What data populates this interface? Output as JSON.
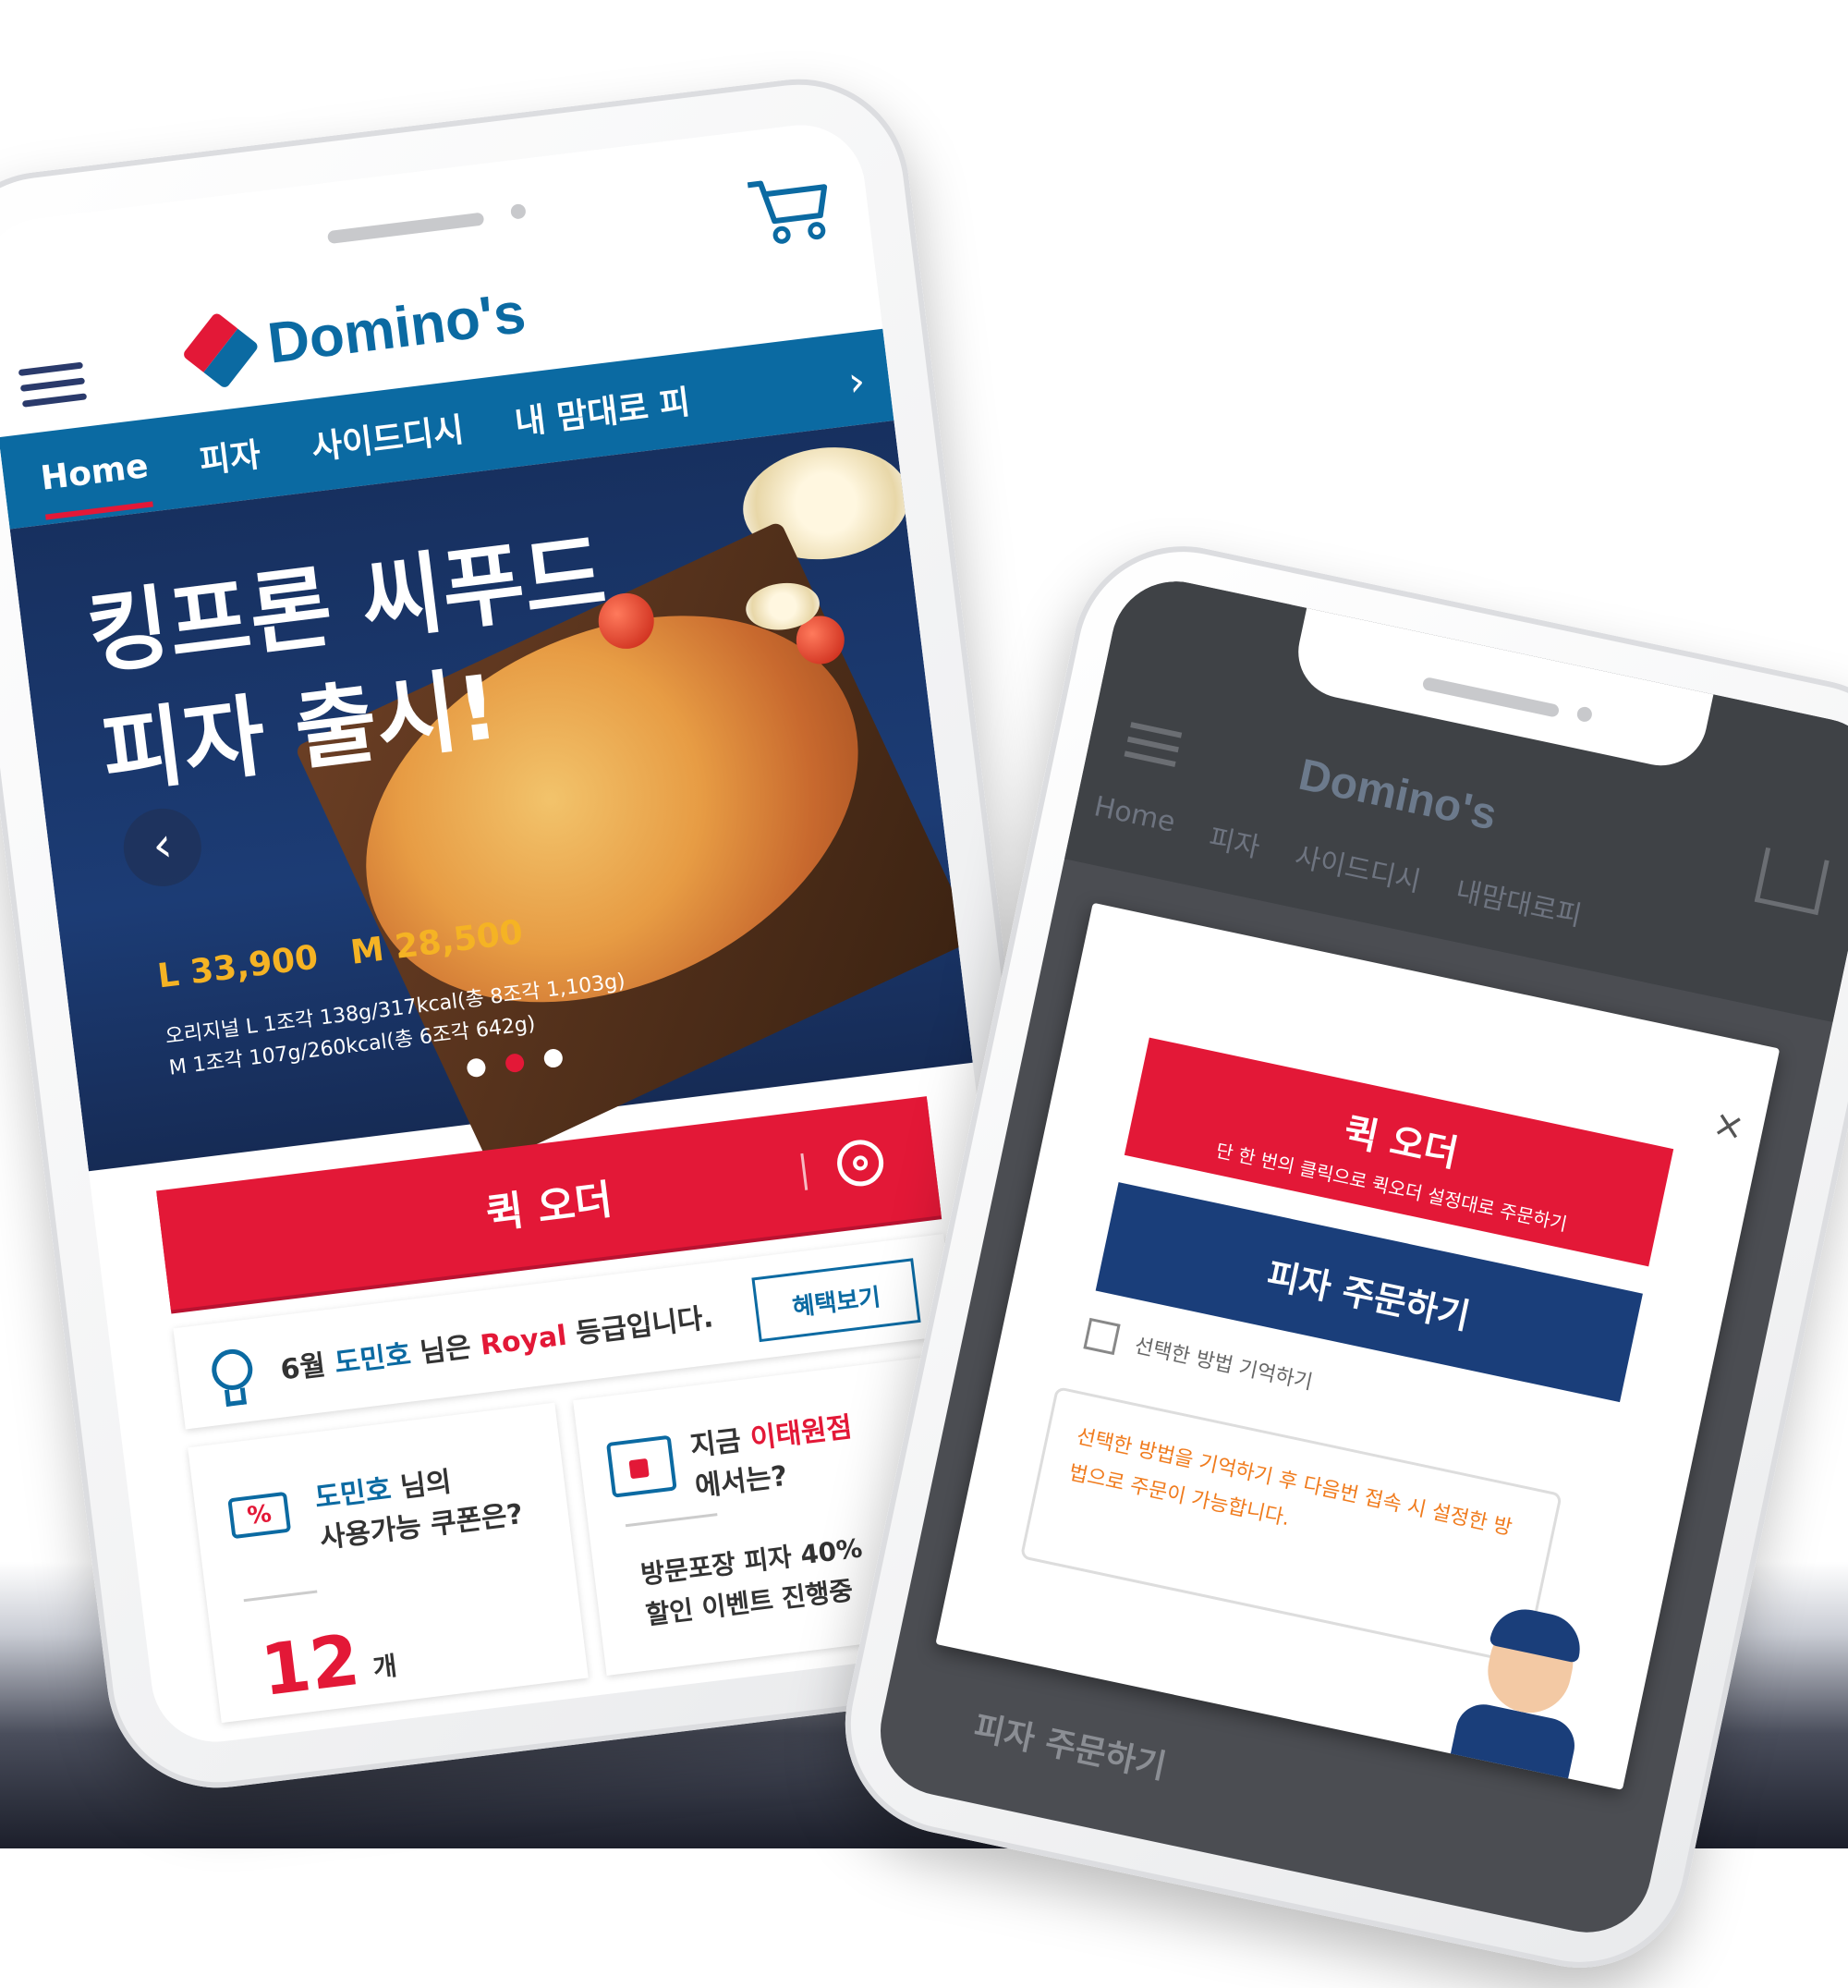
{
  "phone1": {
    "header": {
      "logo_text": "Domino's",
      "menu_icon": "hamburger-icon",
      "cart_icon": "cart-icon"
    },
    "nav": {
      "tabs": [
        {
          "label": "Home"
        },
        {
          "label": "피자"
        },
        {
          "label": "사이드디시"
        },
        {
          "label": "내 맘대로 피"
        }
      ],
      "more_icon": "chevron-right-icon",
      "more_glyph": "›"
    },
    "hero": {
      "title_line1": "킹프론 씨푸드",
      "title_line2": "피자 출시!",
      "prev_glyph": "‹",
      "price_l": "L 33,900",
      "price_m": "M 28,500",
      "detail_line1": "오리지널 L 1조각 138g/317kcal(총 8조각 1,103g)",
      "detail_line2": "M 1조각 107g/260kcal(총 6조각 642g)",
      "active_dot": 1
    },
    "quick_order": {
      "label": "퀵 오더",
      "gear_icon": "gear-icon"
    },
    "grade": {
      "month": "6월",
      "name": "도민호",
      "mid": "님은",
      "level": "Royal",
      "suffix": "등급입니다.",
      "button": "혜택보기"
    },
    "coupon": {
      "name": "도민호",
      "line1_suffix": "님의",
      "line2": "사용가능 쿠폰은?",
      "count": "12",
      "unit": "개",
      "icon_glyph": "%"
    },
    "store": {
      "line1_prefix": "지금",
      "store_name": "이태원점",
      "line2": "에서는?",
      "event_line1": "방문포장 피자 40%",
      "event_line2": "할인 이벤트 진행중"
    }
  },
  "phone2": {
    "header": {
      "logo_text": "Domino's"
    },
    "nav": [
      {
        "label": "Home"
      },
      {
        "label": "피자"
      },
      {
        "label": "사이드디시"
      },
      {
        "label": "내맘대로피"
      }
    ],
    "modal": {
      "close_glyph": "×",
      "quick_order_label": "퀵 오더",
      "quick_order_sub": "단 한 번의 클릭으로 퀵오더 설정대로 주문하기",
      "pizza_order_label": "피자 주문하기",
      "checkbox_label": "선택한 방법 기억하기",
      "bubble_text": "선택한 방법을 기억하기 후 다음번 접속 시 설정한 방법으로 주문이 가능합니다."
    },
    "below_modal_text": "피자 주문하기"
  },
  "colors": {
    "brand_blue": "#0b6aa2",
    "brand_red": "#e31837",
    "hero_navy": "#1c3c75",
    "price_gold": "#f5b324",
    "bubble_orange": "#f07b1d"
  }
}
